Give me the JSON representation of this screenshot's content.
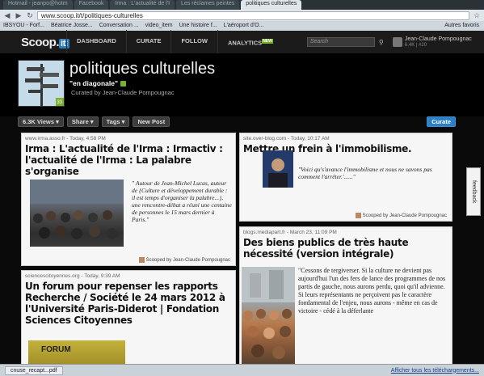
{
  "browser": {
    "tabs": [
      "Hotmail - jeanpo@hotm",
      "Facebook",
      "Irma : L'actualité de l'I",
      "Les réclames peintes",
      "politiques culturelles"
    ],
    "url": "www.scoop.it/t/politiques-culturelles",
    "bookmarks": [
      "IBSYOU - Forf...",
      "Béatrice Josse...",
      "Conversation ...",
      "video_item",
      "Une histoire f...",
      "L'aéroport d'O...",
      "Autres favoris"
    ]
  },
  "header": {
    "logo": "Scoop.",
    "logo_accent": "it!",
    "menu": [
      "DASHBOARD",
      "CURATE",
      "FOLLOW",
      "ANALYTICS"
    ],
    "analytics_badge": "new",
    "search_placeholder": "Search",
    "user_name": "Jean-Claude Pompougnac",
    "user_stats": "6.4K | #20"
  },
  "topic": {
    "title": "politiques culturelles",
    "subtitle": "\"en diagonale\"",
    "curator": "Curated by Jean-Claude Pompougnac",
    "image_badge": "33"
  },
  "toolbar": {
    "views": "6.3K Views",
    "share": "Share",
    "tags": "Tags",
    "new_post": "New Post",
    "curate": "Curate"
  },
  "cards": [
    {
      "meta": "www.irma.asso.fr - Today, 4:58 PM",
      "title": "Irma : L'actualité de l'Irma : Irmactiv : l'actualité de l'Irma : La palabre s'organise",
      "quote": "\" Autour de Jean-Michel Lucas, auteur de {Culture et développement durable : il est temps d'organiser la palabre...}, une rencontre-débat a réuni une centaine de personnes le 15 mars dernier à Paris.\"",
      "scooped": "Scooped by Jean-Claude Pompougnac"
    },
    {
      "meta": "site.over-blog.com - Today, 10:17 AM",
      "title": "Mettre un frein à l'immobilisme.",
      "quote": "\"Voici qu's'avance l'immobilisme et nous ne savons pas comment l'arrêter.'......\"",
      "scooped": "Scooped by Jean-Claude Pompougnac"
    },
    {
      "meta": "blogs.mediapart.fr - March 23, 11:09 PM",
      "title": "Des biens publics de très haute nécessité (version intégrale)",
      "quote": "\"Cessons de tergiverser. Si la culture ne devient pas aujourd'hui l'un des fers de lance des programmes de nos partis de gauche, nous aurons perdu, quoi qu'il advienne. Si leurs représentants ne perçoivent pas le caractère fondamental de l'enjeu, nous aurons - même en cas de victoire - cédé à la déferlante"
    },
    {
      "meta": "sciencescitoyennes.org - Today, 9:39 AM",
      "title": "Un forum pour repenser les rapports Recherche / Société le 24 mars 2012 à l'Université Paris-Diderot | Fondation Sciences Citoyennes",
      "image_text": "FORUM"
    }
  ],
  "feedback": "feedback",
  "downloads": {
    "file": "cnuse_recapt...pdf",
    "show_all": "Afficher tous les téléchargements..."
  }
}
